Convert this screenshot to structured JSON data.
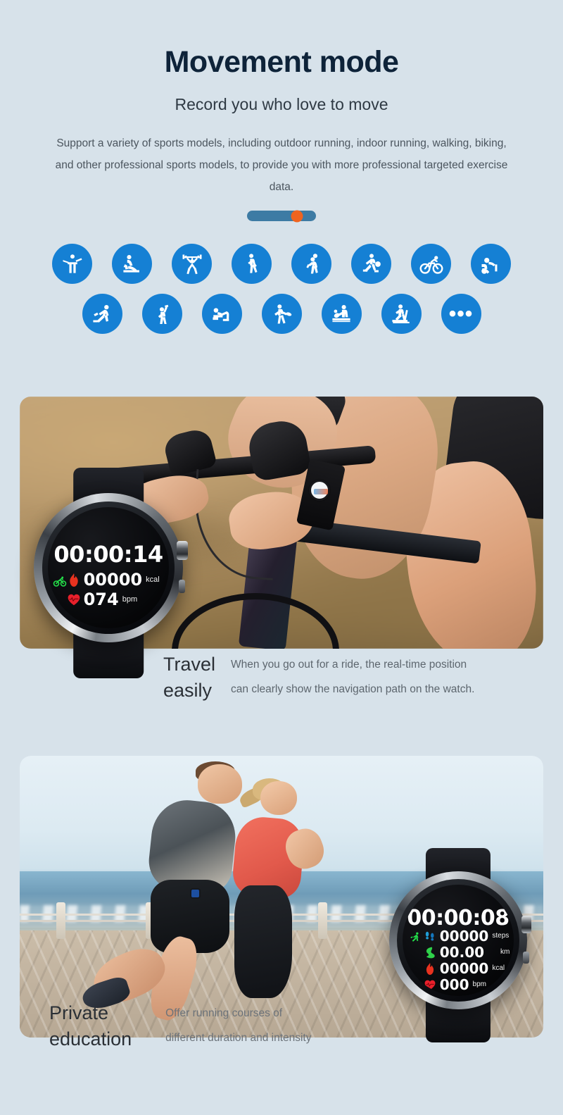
{
  "theme": {
    "background": "#d7e2ea",
    "title_color": "#0e2339",
    "accent_blue": "#1580d4",
    "accent_orange": "#ef6420",
    "slider_track": "#3d7ba4"
  },
  "hero": {
    "title": "Movement mode",
    "subtitle": "Record you who love to move",
    "description": "Support a variety of sports models, including outdoor running, indoor running, walking, biking, and other professional sports models, to provide you with more professional targeted exercise data."
  },
  "slider": {
    "name": "mode-slider",
    "knob_position_percent": 72
  },
  "sports": {
    "row1": [
      {
        "icon": "stretching-icon",
        "label": "Stretching"
      },
      {
        "icon": "rowing-icon",
        "label": "Rowing"
      },
      {
        "icon": "weightlifting-icon",
        "label": "Weightlifting"
      },
      {
        "icon": "walking-icon",
        "label": "Walking"
      },
      {
        "icon": "basketball-icon",
        "label": "Basketball"
      },
      {
        "icon": "volleyball-icon",
        "label": "Volleyball"
      },
      {
        "icon": "cycling-icon",
        "label": "Cycling"
      },
      {
        "icon": "swimming-icon",
        "label": "Swimming"
      }
    ],
    "row2": [
      {
        "icon": "running-icon",
        "label": "Running"
      },
      {
        "icon": "dance-icon",
        "label": "Dance"
      },
      {
        "icon": "situp-icon",
        "label": "Sit-ups"
      },
      {
        "icon": "badminton-icon",
        "label": "Badminton"
      },
      {
        "icon": "table-tennis-icon",
        "label": "Table tennis"
      },
      {
        "icon": "treadmill-icon",
        "label": "Treadmill"
      },
      {
        "icon": "more-icon",
        "label": "More",
        "glyph": "•••"
      }
    ]
  },
  "cards": [
    {
      "id": "cycling-card",
      "photo_alt": "Cyclist riding a road bike outdoors",
      "watch": {
        "name": "cycling-watch",
        "time": "00:00:14",
        "sport_icon": "cycling-icon",
        "metrics": [
          {
            "icon": "flame-icon",
            "value": "00000",
            "unit": "kcal"
          },
          {
            "icon": "heart-icon",
            "value": "074",
            "unit": "bpm"
          }
        ]
      },
      "caption": {
        "title": "Travel\neasily",
        "body": "When you go out for a ride, the real-time position\ncan clearly show the navigation path on the watch."
      }
    },
    {
      "id": "running-card",
      "photo_alt": "Man and woman jogging along a seaside promenade",
      "watch": {
        "name": "running-watch",
        "time": "00:00:08",
        "sport_icon": "running-icon",
        "metrics": [
          {
            "icon": "footsteps-icon",
            "value": "00000",
            "unit": "steps"
          },
          {
            "icon": "distance-icon",
            "value": "00.00",
            "unit": "km"
          },
          {
            "icon": "flame-icon",
            "value": "00000",
            "unit": "kcal"
          },
          {
            "icon": "heart-icon",
            "value": "000",
            "unit": "bpm"
          }
        ]
      },
      "caption": {
        "title": "Private\neducation",
        "body": "Offer running courses of\ndifferent duration and intensity"
      }
    }
  ]
}
